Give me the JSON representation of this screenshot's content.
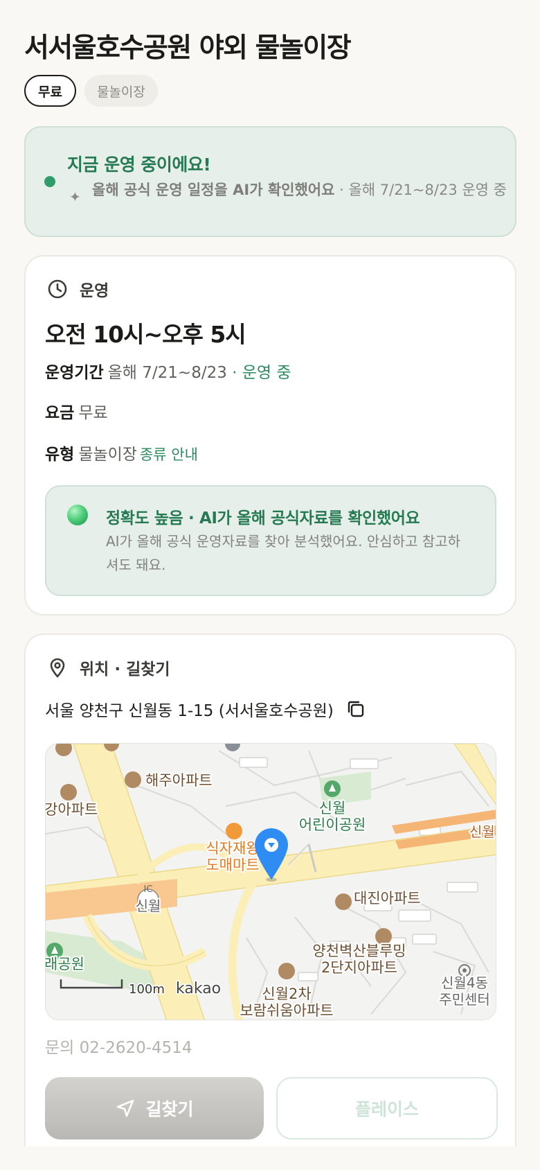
{
  "title": "서서울호수공원 야외 물놀이장",
  "chips": [
    {
      "label": "무료"
    },
    {
      "label": "물놀이장"
    }
  ],
  "status": {
    "title": "지금 운영 중이에요!",
    "ai_note": "올해 공식 운영 일정을 AI가 확인했어요",
    "detail": " · 올해 7/21~8/23 운영 중"
  },
  "operation": {
    "section_title": "운영",
    "hours": "오전 10시~오후 5시",
    "period_label": "운영기간",
    "period_value": "올해 7/21~8/23",
    "period_status": " · 운영 중",
    "fee_label": "요금",
    "fee_value": "무료",
    "type_label": "유형",
    "type_value": "물놀이장",
    "type_link": "종류 안내",
    "accuracy_title": "정확도 높음 · AI가 올해 공식자료를 확인했어요",
    "accuracy_desc": "AI가 올해 공식 운영자료를 찾아 분석했어요. 안심하고 참고하셔도 돼요."
  },
  "location": {
    "section_title": "위치 · 길찾기",
    "address": "서울 양천구 신월동 1-15 (서서울호수공원)",
    "map_labels": {
      "haeju": "해주아파트",
      "gang": "강아파트",
      "sinwol_park_1": "신월",
      "sinwol_park_2": "어린이공원",
      "mart_1": "식자재왕",
      "mart_2": "도매마트",
      "ic_badge": "IC",
      "ic_name": "신월",
      "daejin": "대진아파트",
      "park_left": "래공원",
      "blooming_1": "양천벽산블루밍",
      "blooming_2": "2단지아파트",
      "center_1": "신월4동",
      "center_2": "주민센터",
      "sinwol2_1": "신월2차",
      "sinwol2_2": "보람쉬움아파트",
      "road_right": "신월",
      "scale": "100m",
      "brand": "kakao"
    },
    "phone": "문의 02-2620-4514",
    "route_button": "길찾기",
    "place_button": "플레이스"
  },
  "colors": {
    "accent_green": "#267a52",
    "status_bg": "#e6efea",
    "marker_blue": "#2f8cf2"
  },
  "icons": {
    "clock": "clock-icon",
    "location": "location-pin-icon",
    "copy": "copy-icon",
    "navigate": "navigation-arrow-icon",
    "sparkle": "sparkle-icon"
  }
}
